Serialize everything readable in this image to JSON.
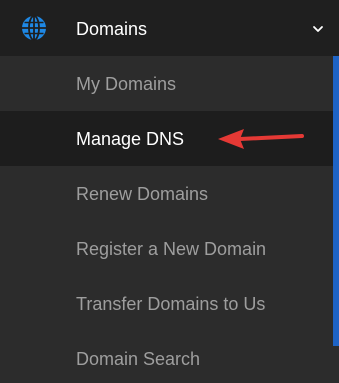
{
  "header": {
    "title": "Domains",
    "icon": "globe-icon",
    "chevron_icon": "chevron-down-icon"
  },
  "menu": {
    "items": [
      {
        "label": "My Domains",
        "active": false
      },
      {
        "label": "Manage DNS",
        "active": true
      },
      {
        "label": "Renew Domains",
        "active": false
      },
      {
        "label": "Register a New Domain",
        "active": false
      },
      {
        "label": "Transfer Domains to Us",
        "active": false
      },
      {
        "label": "Domain Search",
        "active": false
      }
    ]
  },
  "colors": {
    "accent": "#1e63c5",
    "arrow": "#e53935",
    "header_bg": "#1f1f1f",
    "menu_bg": "#2c2c2c",
    "active_bg": "#1d1d1d",
    "inactive_text": "#9e9e9e",
    "active_text": "#ffffff"
  }
}
